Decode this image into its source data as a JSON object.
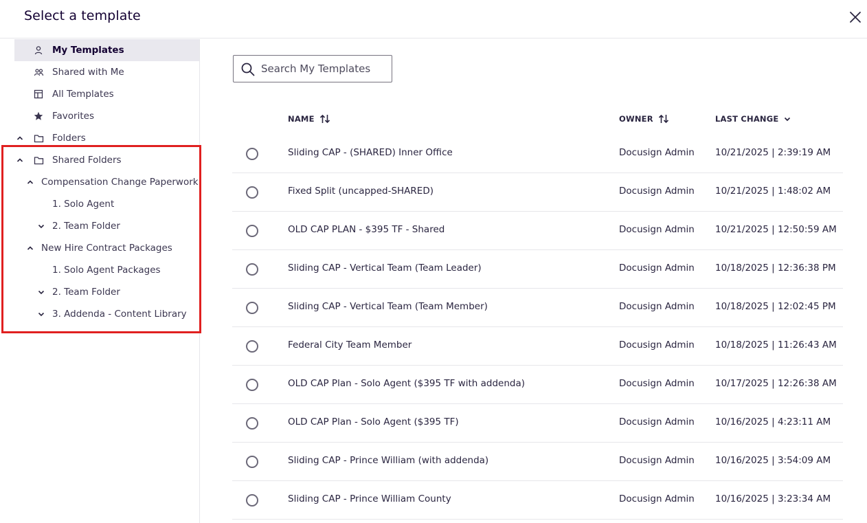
{
  "dialog": {
    "title": "Select a template"
  },
  "sidebar": {
    "items": [
      {
        "label": "My Templates",
        "icon": "person-icon"
      },
      {
        "label": "Shared with Me",
        "icon": "people-icon"
      },
      {
        "label": "All Templates",
        "icon": "templates-icon"
      },
      {
        "label": "Favorites",
        "icon": "star-icon"
      },
      {
        "label": "Folders",
        "icon": "folder-icon",
        "expanded": true
      },
      {
        "label": "Shared Folders",
        "icon": "folder-icon",
        "expanded": true
      },
      {
        "label": "Compensation Change Paperwork",
        "expanded": true
      },
      {
        "label": "1. Solo Agent"
      },
      {
        "label": "2. Team Folder",
        "expanded": false
      },
      {
        "label": "New Hire Contract Packages",
        "expanded": true
      },
      {
        "label": "1. Solo Agent Packages"
      },
      {
        "label": "2. Team Folder",
        "expanded": false
      },
      {
        "label": "3. Addenda - Content Library",
        "expanded": false
      }
    ],
    "active": "My Templates"
  },
  "search": {
    "placeholder": "Search My Templates",
    "value": ""
  },
  "table": {
    "columns": [
      {
        "label": "NAME",
        "sort": "sortable"
      },
      {
        "label": "OWNER",
        "sort": "sortable"
      },
      {
        "label": "LAST CHANGE",
        "sort": "descending"
      }
    ],
    "rows": [
      {
        "name": "Sliding CAP - (SHARED) Inner Office",
        "owner": "Docusign Admin",
        "last_change": "10/21/2025 | 2:39:19 AM"
      },
      {
        "name": "Fixed Split (uncapped-SHARED)",
        "owner": "Docusign Admin",
        "last_change": "10/21/2025 | 1:48:02 AM"
      },
      {
        "name": "OLD CAP PLAN - $395 TF - Shared",
        "owner": "Docusign Admin",
        "last_change": "10/21/2025 | 12:50:59 AM"
      },
      {
        "name": "Sliding CAP - Vertical Team (Team Leader)",
        "owner": "Docusign Admin",
        "last_change": "10/18/2025 | 12:36:38 PM"
      },
      {
        "name": "Sliding CAP - Vertical Team (Team Member)",
        "owner": "Docusign Admin",
        "last_change": "10/18/2025 | 12:02:45 PM"
      },
      {
        "name": "Federal City Team Member",
        "owner": "Docusign Admin",
        "last_change": "10/18/2025 | 11:26:43 AM"
      },
      {
        "name": "OLD CAP Plan - Solo Agent ($395 TF with addenda)",
        "owner": "Docusign Admin",
        "last_change": "10/17/2025 | 12:26:38 AM"
      },
      {
        "name": "OLD CAP Plan - Solo Agent ($395 TF)",
        "owner": "Docusign Admin",
        "last_change": "10/16/2025 | 4:23:11 AM"
      },
      {
        "name": "Sliding CAP - Prince William (with addenda)",
        "owner": "Docusign Admin",
        "last_change": "10/16/2025 | 3:54:09 AM"
      },
      {
        "name": "Sliding CAP - Prince William County",
        "owner": "Docusign Admin",
        "last_change": "10/16/2025 | 3:23:34 AM"
      }
    ]
  },
  "colors": {
    "highlight": "#e02020",
    "active_bg": "#e9e8ee",
    "text": "#2a2540"
  }
}
